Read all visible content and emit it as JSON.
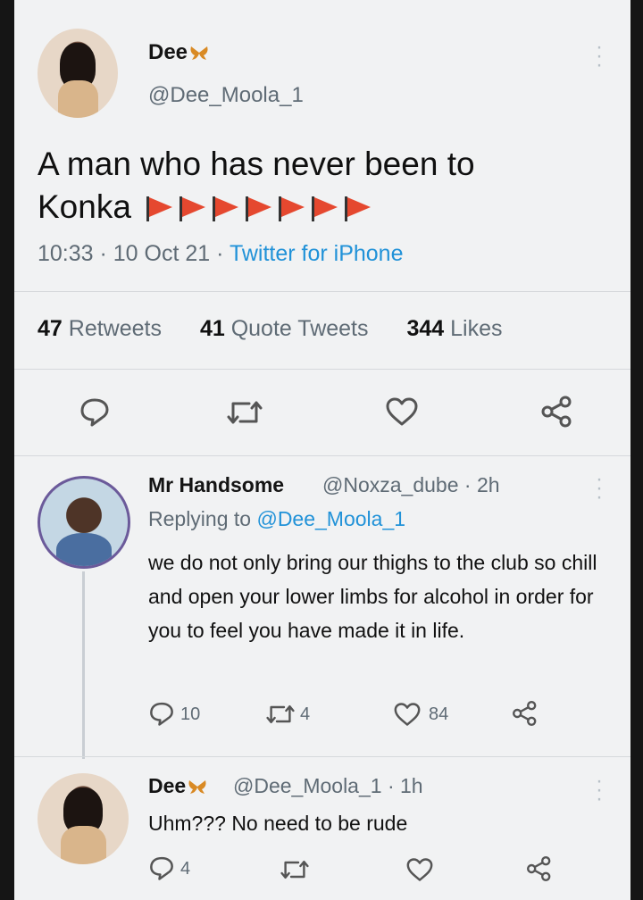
{
  "original_tweet": {
    "display_name": "Dee",
    "handle": "@Dee_Moola_1",
    "text_line1": "A man who has never been to",
    "text_line2": "Konka",
    "timestamp": "10:33 · 10 Oct 21 · ",
    "source": "Twitter for iPhone",
    "stats": {
      "retweets_count": "47",
      "retweets_label": "Retweets",
      "quotes_count": "41",
      "quotes_label": "Quote Tweets",
      "likes_count": "344",
      "likes_label": "Likes"
    },
    "flag_color": "#e5482f"
  },
  "reply_1": {
    "display_name": "Mr Handsome",
    "handle_time": "@Noxza_dube · 2h",
    "replying_prefix": "Replying to ",
    "replying_to": "@Dee_Moola_1",
    "text": "we do not only bring our thighs to the club so chill and open your lower limbs for alcohol in order for you to feel you have made it in life.",
    "reply_count": "10",
    "retweet_count": "4",
    "like_count": "84"
  },
  "reply_2": {
    "display_name": "Dee",
    "handle_time": "@Dee_Moola_1 · 1h",
    "text": "Uhm??? No need to be rude",
    "reply_count": "4"
  },
  "colors": {
    "link_blue": "#2192d8",
    "secondary_text": "#5f6b75",
    "background": "#f1f2f3",
    "butterfly": "#d98a24"
  },
  "icons": [
    "reply-icon",
    "retweet-icon",
    "like-icon",
    "share-icon",
    "more-icon",
    "butterfly-icon",
    "flag-icon"
  ]
}
